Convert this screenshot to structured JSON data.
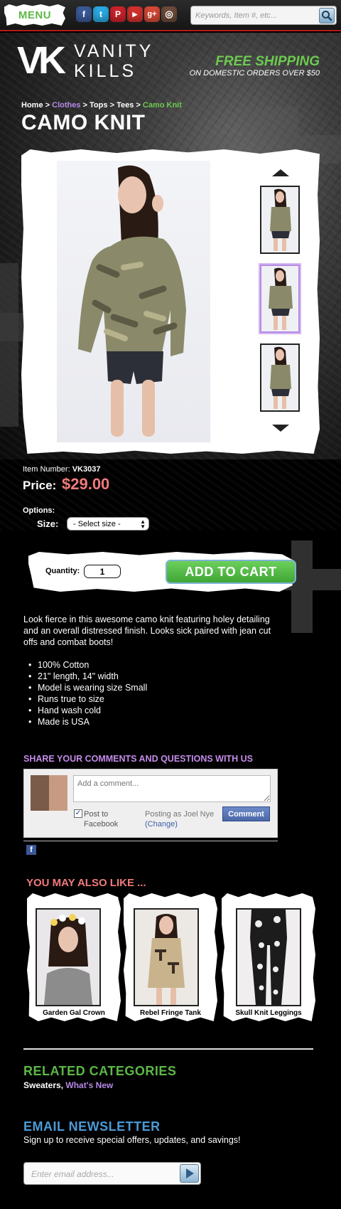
{
  "topbar": {
    "menu_label": "MENU",
    "social": [
      {
        "name": "facebook-icon",
        "glyph": "f",
        "color": "#3b5998"
      },
      {
        "name": "twitter-icon",
        "glyph": "t",
        "color": "#29a9e1"
      },
      {
        "name": "pinterest-icon",
        "glyph": "P",
        "color": "#c9222a"
      },
      {
        "name": "youtube-icon",
        "glyph": "▶",
        "color": "#d0312d"
      },
      {
        "name": "google-plus-icon",
        "glyph": "g+",
        "color": "#d34836"
      },
      {
        "name": "instagram-icon",
        "glyph": "◎",
        "color": "#6b4a3a"
      }
    ],
    "search_placeholder": "Keywords, Item #, etc..."
  },
  "header": {
    "logo_mark": "VK",
    "logo_line1": "VANITY",
    "logo_line2": "KILLS",
    "free_shipping": "FREE SHIPPING",
    "free_shipping_sub": "ON DOMESTIC ORDERS OVER $50"
  },
  "breadcrumb": {
    "home": "Home",
    "sep": ">",
    "clothes": "Clothes",
    "tops": "Tops",
    "tees": "Tees",
    "current": "Camo Knit"
  },
  "product": {
    "title": "CAMO KNIT",
    "item_number_label": "Item Number:",
    "item_number": "VK3037",
    "price_label": "Price:",
    "price": "$29.00",
    "options_label": "Options:",
    "size_label": "Size:",
    "size_selected": "- Select size -",
    "quantity_label": "Quantity:",
    "quantity": "1",
    "add_to_cart": "ADD TO CART",
    "active_thumbnail": 2
  },
  "description": {
    "text": "Look fierce in this awesome camo knit featuring holey detailing and an overall distressed finish. Looks sick paired with jean cut offs and combat boots!",
    "features": [
      "100% Cotton",
      "21\" length, 14\" width",
      "Model is wearing size Small",
      "Runs true to size",
      "Hand wash cold",
      "Made is USA"
    ]
  },
  "comments": {
    "heading": "SHARE YOUR COMMENTS AND QUESTIONS WITH US",
    "placeholder": "Add a comment...",
    "post_to_facebook": "Post to Facebook",
    "posting_as": "Posting as Joel Nye",
    "change": "(Change)",
    "button": "Comment",
    "facebook_glyph": "f"
  },
  "recommendations": {
    "heading": "YOU MAY ALSO LIKE ...",
    "items": [
      {
        "name": "Garden Gal Crown"
      },
      {
        "name": "Rebel Fringe Tank"
      },
      {
        "name": "Skull Knit Leggings"
      }
    ]
  },
  "related": {
    "heading": "RELATED CATEGORIES",
    "link1": "Sweaters",
    "separator": ",",
    "link2": "What's New"
  },
  "newsletter": {
    "heading": "EMAIL NEWSLETTER",
    "subtext": "Sign up to receive special offers, updates, and savings!",
    "placeholder": "Enter email address..."
  },
  "colors": {
    "accent_green": "#5cb845",
    "accent_purple": "#b689e6",
    "price_red": "#f07a7a",
    "newsletter_blue": "#4b9ad6",
    "topbar_rule": "#b51d1d"
  }
}
